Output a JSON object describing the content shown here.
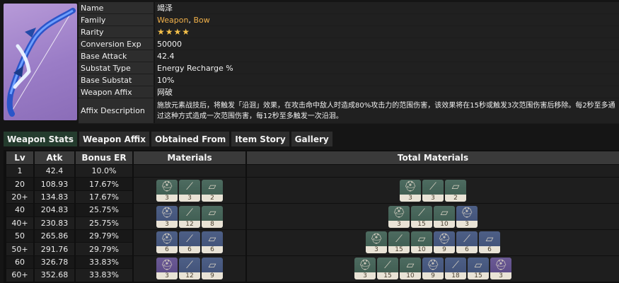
{
  "weapon": {
    "info": [
      {
        "key": "Name",
        "value": "竭泽"
      },
      {
        "key": "Family",
        "value_parts": [
          "Weapon",
          ", ",
          "Bow"
        ]
      },
      {
        "key": "Rarity",
        "value": "★★★★"
      },
      {
        "key": "Conversion Exp",
        "value": "50000"
      },
      {
        "key": "Base Attack",
        "value": "42.4"
      },
      {
        "key": "Substat Type",
        "value": "Energy Recharge %"
      },
      {
        "key": "Base Substat",
        "value": "10%"
      },
      {
        "key": "Weapon Affix",
        "value": "网破"
      },
      {
        "key": "Affix Description",
        "value": "施放元素战技后，将触发「沿洄」效果，在攻击命中敌人时造成80%攻击力的范围伤害，该效果将在15秒或触发3次范围伤害后移除。每2秒至多通过这种方式造成一次范围伤害，每12秒至多触发一次沿洄。"
      }
    ]
  },
  "tabs": [
    "Weapon Stats",
    "Weapon Affix",
    "Obtained From",
    "Item Story",
    "Gallery"
  ],
  "active_tab": "Weapon Stats",
  "table": {
    "headers": [
      "Lv",
      "Atk",
      "Bonus ER",
      "Materials",
      "Total Materials"
    ],
    "rows": [
      {
        "lv": "1",
        "atk": "42.4",
        "er": "10.0%"
      },
      {
        "lv": "20",
        "atk": "108.93",
        "er": "17.67%"
      },
      {
        "lv": "20+",
        "atk": "134.83",
        "er": "17.67%"
      },
      {
        "lv": "40",
        "atk": "204.83",
        "er": "25.75%"
      },
      {
        "lv": "40+",
        "atk": "230.83",
        "er": "25.75%"
      },
      {
        "lv": "50",
        "atk": "265.86",
        "er": "29.79%"
      },
      {
        "lv": "50+",
        "atk": "291.76",
        "er": "29.79%"
      },
      {
        "lv": "60",
        "atk": "326.78",
        "er": "33.83%"
      },
      {
        "lv": "60+",
        "atk": "352.68",
        "er": "33.83%"
      }
    ],
    "materials": [
      [
        {
          "q": "q2",
          "icon": "helmet-icon",
          "count": "3"
        },
        {
          "q": "q2",
          "icon": "tusk-icon",
          "count": "3"
        },
        {
          "q": "q2",
          "icon": "scroll-icon",
          "count": "2"
        }
      ],
      [
        {
          "q": "q3",
          "icon": "helmet-icon",
          "count": "3"
        },
        {
          "q": "q2",
          "icon": "tusk-icon",
          "count": "12"
        },
        {
          "q": "q2",
          "icon": "scroll-icon",
          "count": "8"
        }
      ],
      [
        {
          "q": "q3",
          "icon": "helmet-icon",
          "count": "6"
        },
        {
          "q": "q3",
          "icon": "tusk-icon",
          "count": "6"
        },
        {
          "q": "q3",
          "icon": "scroll-icon",
          "count": "6"
        }
      ],
      [
        {
          "q": "q4",
          "icon": "helmet-icon",
          "count": "3"
        },
        {
          "q": "q3",
          "icon": "tusk-icon",
          "count": "12"
        },
        {
          "q": "q3",
          "icon": "scroll-icon",
          "count": "9"
        }
      ]
    ],
    "totals": [
      [
        {
          "q": "q2",
          "icon": "helmet-icon",
          "count": "3"
        },
        {
          "q": "q2",
          "icon": "tusk-icon",
          "count": "3"
        },
        {
          "q": "q2",
          "icon": "scroll-icon",
          "count": "2"
        }
      ],
      [
        {
          "q": "q2",
          "icon": "helmet-icon",
          "count": "3"
        },
        {
          "q": "q2",
          "icon": "tusk-icon",
          "count": "15"
        },
        {
          "q": "q2",
          "icon": "scroll-icon",
          "count": "10"
        },
        {
          "q": "q3",
          "icon": "helmet-icon",
          "count": "3"
        }
      ],
      [
        {
          "q": "q2",
          "icon": "helmet-icon",
          "count": "3"
        },
        {
          "q": "q2",
          "icon": "tusk-icon",
          "count": "15"
        },
        {
          "q": "q2",
          "icon": "scroll-icon",
          "count": "10"
        },
        {
          "q": "q3",
          "icon": "helmet-icon",
          "count": "9"
        },
        {
          "q": "q3",
          "icon": "tusk-icon",
          "count": "6"
        },
        {
          "q": "q3",
          "icon": "scroll-icon",
          "count": "6"
        }
      ],
      [
        {
          "q": "q2",
          "icon": "helmet-icon",
          "count": "3"
        },
        {
          "q": "q2",
          "icon": "tusk-icon",
          "count": "15"
        },
        {
          "q": "q2",
          "icon": "scroll-icon",
          "count": "10"
        },
        {
          "q": "q3",
          "icon": "helmet-icon",
          "count": "9"
        },
        {
          "q": "q3",
          "icon": "tusk-icon",
          "count": "18"
        },
        {
          "q": "q3",
          "icon": "scroll-icon",
          "count": "15"
        },
        {
          "q": "q4",
          "icon": "helmet-icon",
          "count": "3"
        }
      ]
    ]
  }
}
